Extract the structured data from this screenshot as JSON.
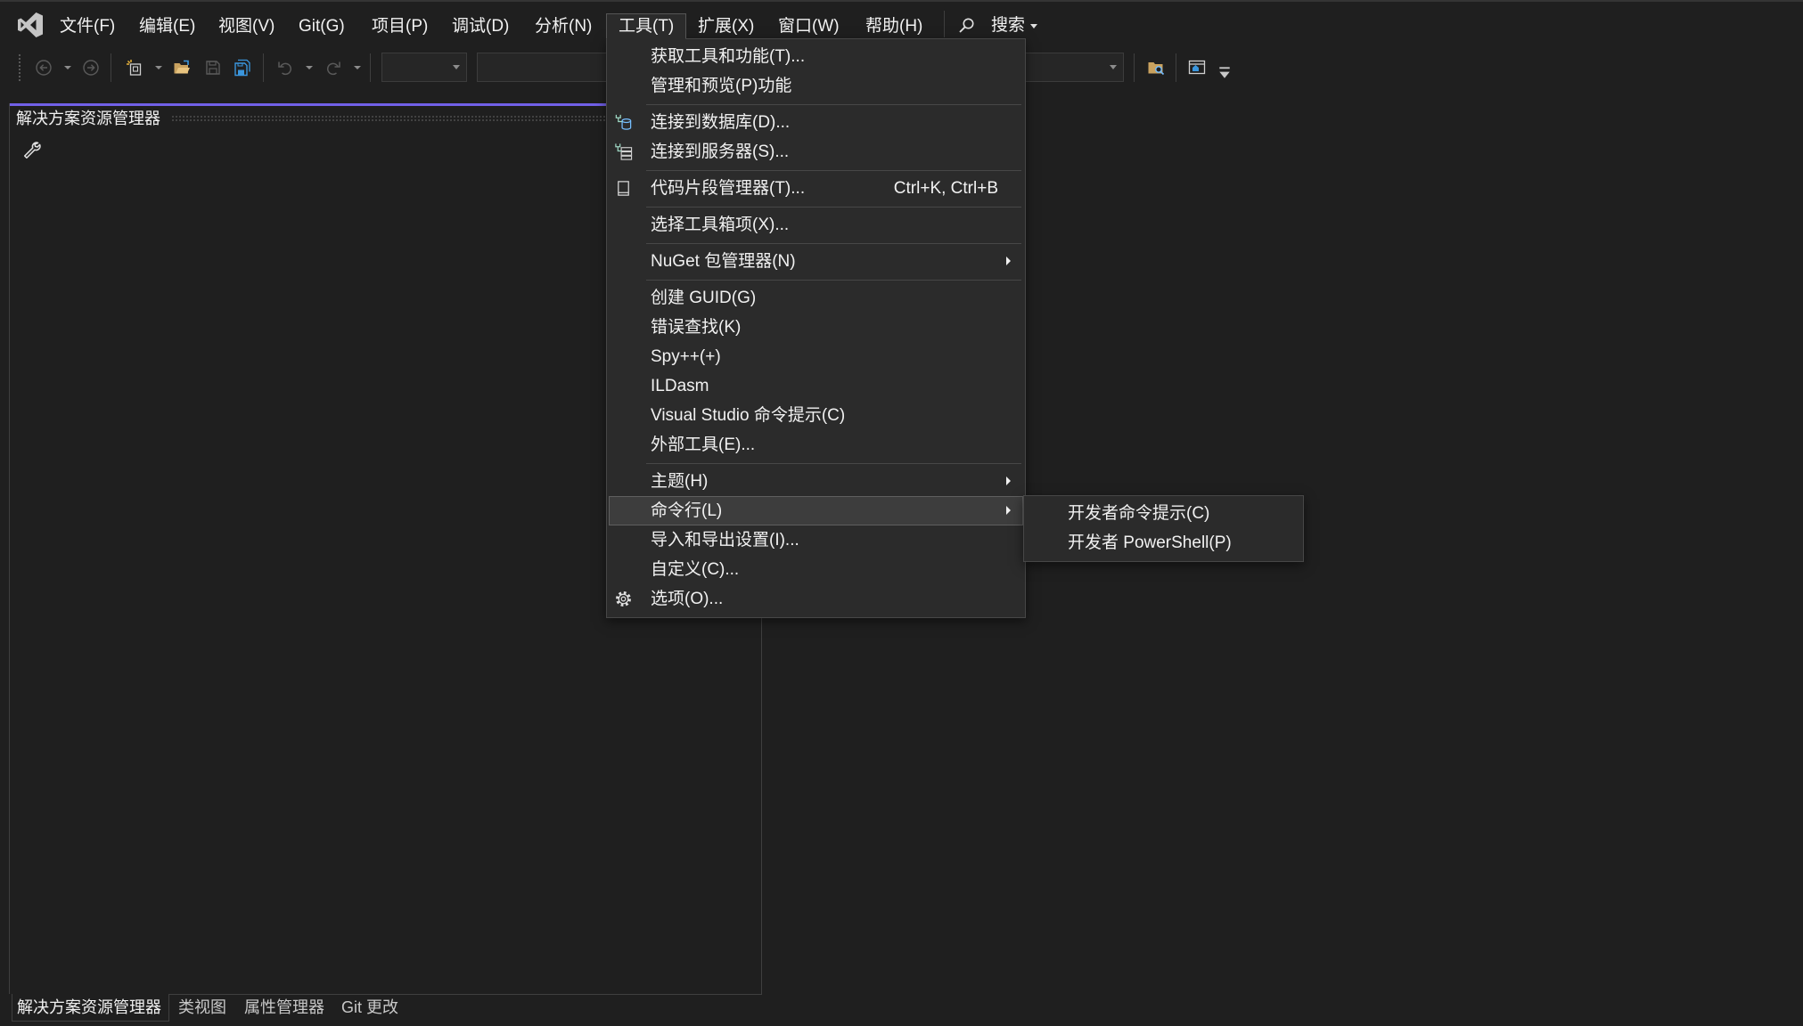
{
  "menubar": {
    "logo_icon": "visual-studio-logo-icon",
    "items": [
      {
        "label": "文件(F)",
        "open": false
      },
      {
        "label": "编辑(E)",
        "open": false
      },
      {
        "label": "视图(V)",
        "open": false
      },
      {
        "label": "Git(G)",
        "open": false
      },
      {
        "label": "项目(P)",
        "open": false
      },
      {
        "label": "调试(D)",
        "open": false
      },
      {
        "label": "分析(N)",
        "open": false
      },
      {
        "label": "工具(T)",
        "open": true
      },
      {
        "label": "扩展(X)",
        "open": false
      },
      {
        "label": "窗口(W)",
        "open": false
      },
      {
        "label": "帮助(H)",
        "open": false
      }
    ],
    "search_icon": "search-icon",
    "search_label": "搜索"
  },
  "toolbar": {
    "buttons": [
      {
        "icon": "navigate-back-icon",
        "enabled": false
      },
      {
        "icon": "navigate-forward-icon",
        "enabled": false
      },
      {
        "icon": "new-project-icon",
        "enabled": true
      },
      {
        "icon": "open-folder-icon",
        "enabled": true
      },
      {
        "icon": "save-icon",
        "enabled": false
      },
      {
        "icon": "save-all-icon",
        "enabled": true
      },
      {
        "icon": "undo-icon",
        "enabled": false
      },
      {
        "icon": "redo-icon",
        "enabled": false
      },
      {
        "icon": "find-in-files-icon",
        "enabled": true
      },
      {
        "icon": "browse-window-icon",
        "enabled": true
      }
    ],
    "configuration_combo": {
      "value": ""
    },
    "target_combo": {
      "value": ""
    }
  },
  "tools_menu": {
    "items": [
      {
        "label": "获取工具和功能(T)...",
        "shortcut": "",
        "icon": "",
        "submenu": false,
        "highlighted": false,
        "separator_after": false
      },
      {
        "label": "管理和预览(P)功能",
        "shortcut": "",
        "icon": "",
        "submenu": false,
        "highlighted": false,
        "separator_after": true
      },
      {
        "label": "连接到数据库(D)...",
        "shortcut": "",
        "icon": "database-connect-icon",
        "submenu": false,
        "highlighted": false,
        "separator_after": false
      },
      {
        "label": "连接到服务器(S)...",
        "shortcut": "",
        "icon": "server-connect-icon",
        "submenu": false,
        "highlighted": false,
        "separator_after": true
      },
      {
        "label": "代码片段管理器(T)...",
        "shortcut": "Ctrl+K, Ctrl+B",
        "icon": "code-snippet-icon",
        "submenu": false,
        "highlighted": false,
        "separator_after": true
      },
      {
        "label": "选择工具箱项(X)...",
        "shortcut": "",
        "icon": "",
        "submenu": false,
        "highlighted": false,
        "separator_after": true
      },
      {
        "label": "NuGet 包管理器(N)",
        "shortcut": "",
        "icon": "",
        "submenu": true,
        "highlighted": false,
        "separator_after": true
      },
      {
        "label": "创建 GUID(G)",
        "shortcut": "",
        "icon": "",
        "submenu": false,
        "highlighted": false,
        "separator_after": false
      },
      {
        "label": "错误查找(K)",
        "shortcut": "",
        "icon": "",
        "submenu": false,
        "highlighted": false,
        "separator_after": false
      },
      {
        "label": "Spy++(+)",
        "shortcut": "",
        "icon": "",
        "submenu": false,
        "highlighted": false,
        "separator_after": false
      },
      {
        "label": "ILDasm",
        "shortcut": "",
        "icon": "",
        "submenu": false,
        "highlighted": false,
        "separator_after": false
      },
      {
        "label": "Visual Studio 命令提示(C)",
        "shortcut": "",
        "icon": "",
        "submenu": false,
        "highlighted": false,
        "separator_after": false
      },
      {
        "label": "外部工具(E)...",
        "shortcut": "",
        "icon": "",
        "submenu": false,
        "highlighted": false,
        "separator_after": true
      },
      {
        "label": "主题(H)",
        "shortcut": "",
        "icon": "",
        "submenu": true,
        "highlighted": false,
        "separator_after": false
      },
      {
        "label": "命令行(L)",
        "shortcut": "",
        "icon": "",
        "submenu": true,
        "highlighted": true,
        "separator_after": false
      },
      {
        "label": "导入和导出设置(I)...",
        "shortcut": "",
        "icon": "",
        "submenu": false,
        "highlighted": false,
        "separator_after": false
      },
      {
        "label": "自定义(C)...",
        "shortcut": "",
        "icon": "",
        "submenu": false,
        "highlighted": false,
        "separator_after": false
      },
      {
        "label": "选项(O)...",
        "shortcut": "",
        "icon": "gear-icon",
        "submenu": false,
        "highlighted": false,
        "separator_after": false
      }
    ]
  },
  "command_line_submenu": {
    "items": [
      {
        "label": "开发者命令提示(C)"
      },
      {
        "label": "开发者 PowerShell(P)"
      }
    ]
  },
  "solution_explorer": {
    "title": "解决方案资源管理器",
    "toolbar_icon": "wrench-icon"
  },
  "bottom_tabs": [
    {
      "label": "解决方案资源管理器",
      "active": true
    },
    {
      "label": "类视图",
      "active": false
    },
    {
      "label": "属性管理器",
      "active": false
    },
    {
      "label": "Git 更改",
      "active": false
    }
  ],
  "colors": {
    "background": "#1f1f1f",
    "menu_background": "#2b2b2b",
    "menu_border": "#474747",
    "menu_highlight": "#3d3d3d",
    "text": "#f1f1f1",
    "accent": "#7160e8",
    "separator": "#474747"
  }
}
